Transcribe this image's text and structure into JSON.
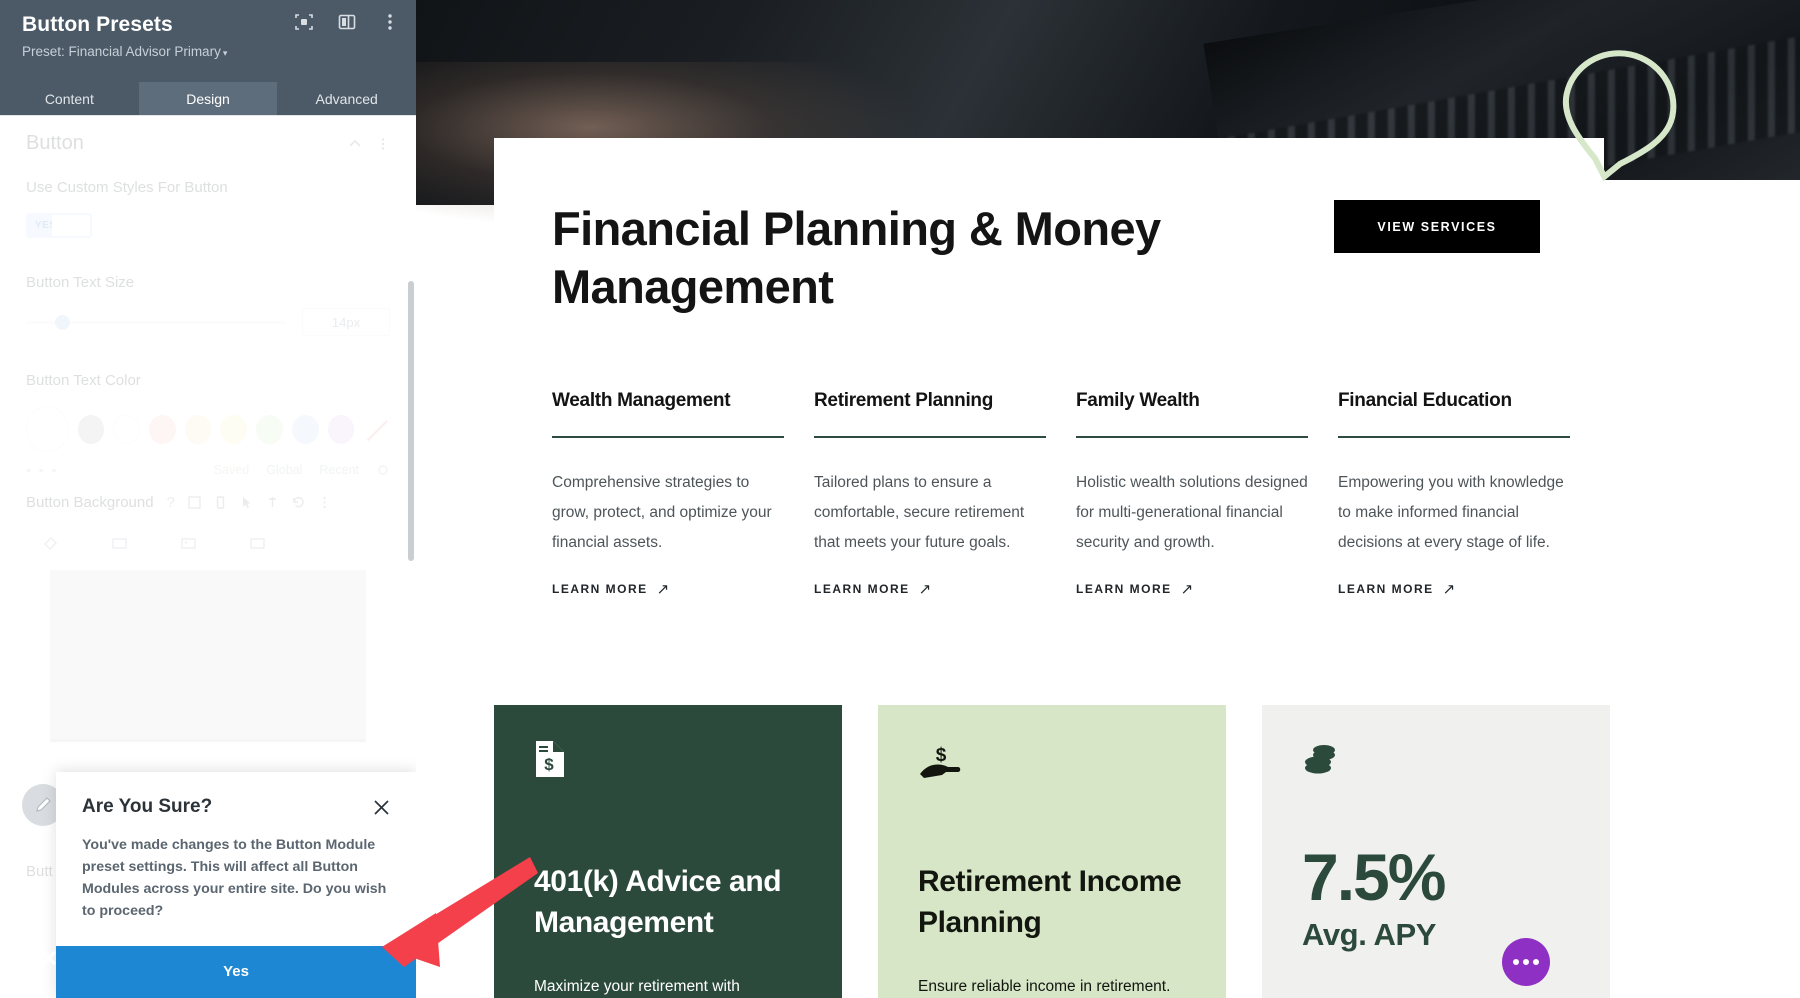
{
  "panel": {
    "title": "Button Presets",
    "subtitle": "Preset: Financial Advisor Primary",
    "subtitle_caret": "▾",
    "icons": [
      {
        "name": "focus-target-icon"
      },
      {
        "name": "layout-panel-icon"
      },
      {
        "name": "more-vertical-icon"
      }
    ],
    "tabs": [
      {
        "label": "Content",
        "active": false
      },
      {
        "label": "Design",
        "active": true
      },
      {
        "label": "Advanced",
        "active": false
      }
    ],
    "settings": {
      "section_title": "Button",
      "use_custom_styles_label": "Use Custom Styles For Button",
      "toggle_value": "YES",
      "text_size_label": "Button Text Size",
      "text_size_value": "14px",
      "text_color_label": "Button Text Color",
      "swatch_dots": "• • •",
      "meta": [
        "Saved",
        "Global",
        "Recent"
      ],
      "background_label": "Button Background",
      "bottom_label": "Butt"
    },
    "confirm": {
      "title": "Are You Sure?",
      "body": "You've made changes to the Button Module preset settings. This will affect all Button Modules across your entire site. Do you wish to proceed?",
      "yes_label": "Yes",
      "close_icon": "close-icon"
    }
  },
  "page": {
    "hero_heading": "Financial Planning & Money Management",
    "cta_label": "VIEW SERVICES",
    "columns": [
      {
        "title": "Wealth Management",
        "desc": "Comprehensive strategies to grow, protect, and optimize your financial assets.",
        "link": "LEARN MORE",
        "arrow": "↗"
      },
      {
        "title": "Retirement Planning",
        "desc": "Tailored plans to ensure a comfortable, secure retirement that meets your future goals.",
        "link": "LEARN MORE",
        "arrow": "↗"
      },
      {
        "title": "Family Wealth",
        "desc": "Holistic wealth solutions designed for multi-generational financial security and growth.",
        "link": "LEARN MORE",
        "arrow": "↗"
      },
      {
        "title": "Financial Education",
        "desc": "Empowering you with knowledge to make informed financial decisions at every stage of life.",
        "link": "LEARN MORE",
        "arrow": "↗"
      }
    ],
    "cards": [
      {
        "icon": "invoice-document-dollar-icon",
        "title": "401(k) Advice and Management",
        "desc": "Maximize your retirement with",
        "style": "dark"
      },
      {
        "icon": "hand-holding-dollar-icon",
        "title": "Retirement Income Planning",
        "desc": "Ensure reliable income in retirement.",
        "style": "light"
      },
      {
        "icon": "stacked-coins-icon",
        "stat_value": "7.5%",
        "stat_label": "Avg. APY",
        "style": "grey"
      }
    ],
    "fab": {
      "name": "more-options-fab",
      "dots": 3
    }
  },
  "colors": {
    "panel_header": "#4c5a67",
    "accent_blue": "#1e87d3",
    "card_dark_green": "#2c4a3c",
    "card_light_green": "#d6e6c7",
    "card_grey": "#f0f0ee",
    "fab_purple": "#8e30c4",
    "annotation_red": "#f4404a",
    "pin_outline": "#d6e8c9"
  }
}
